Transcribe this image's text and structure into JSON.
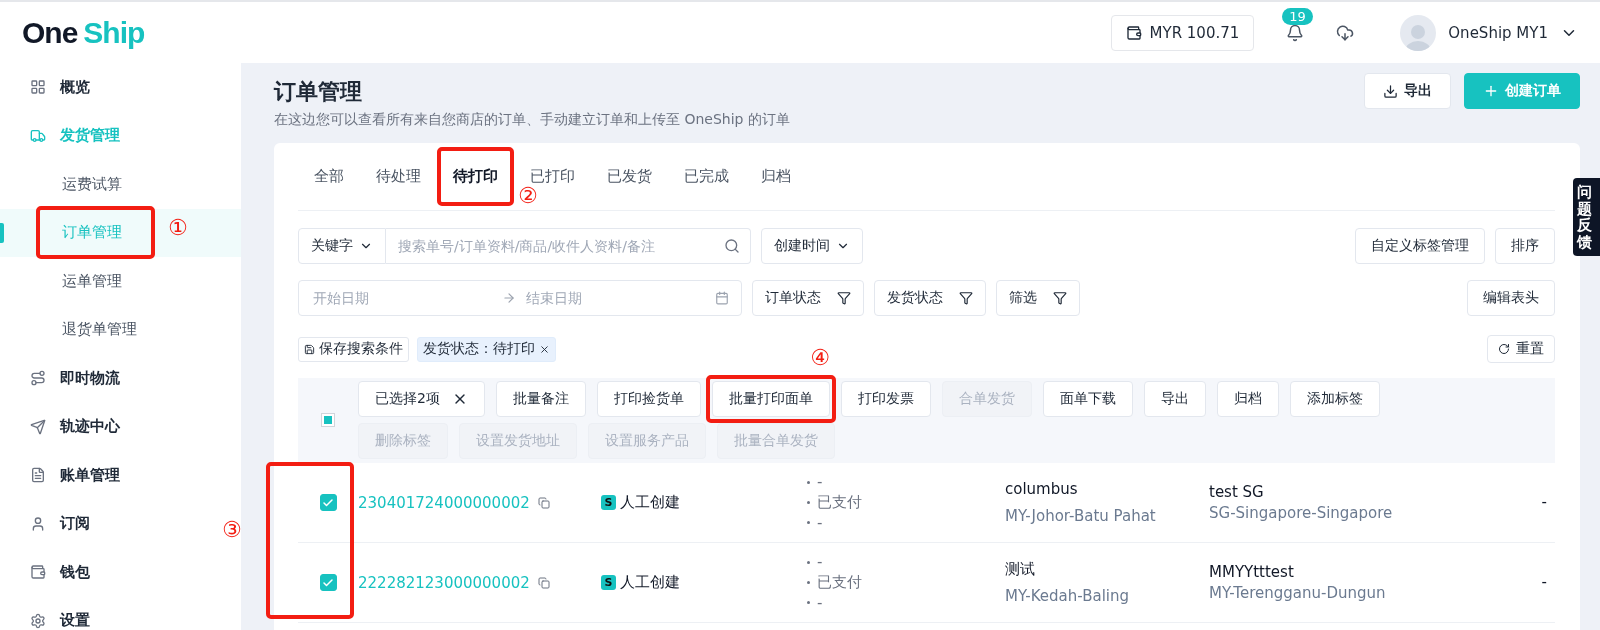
{
  "header": {
    "logo_left": "One",
    "logo_right": "Ship",
    "balance": "MYR 100.71",
    "notification_count": "19",
    "user_name": "OneShip MY1"
  },
  "sidebar": {
    "items": [
      {
        "label": "概览",
        "selected": false
      },
      {
        "label": "发货管理",
        "selected": false,
        "children": [
          {
            "label": "运费试算",
            "selected": false
          },
          {
            "label": "订单管理",
            "selected": true,
            "annotation": "①"
          },
          {
            "label": "运单管理",
            "selected": false
          },
          {
            "label": "退货单管理",
            "selected": false
          }
        ]
      },
      {
        "label": "即时物流",
        "selected": false
      },
      {
        "label": "轨迹中心",
        "selected": false
      },
      {
        "label": "账单管理",
        "selected": false
      },
      {
        "label": "订阅",
        "selected": false
      },
      {
        "label": "钱包",
        "selected": false
      },
      {
        "label": "设置",
        "selected": false
      }
    ]
  },
  "page": {
    "title": "订单管理",
    "subtitle": "在这边您可以查看所有来自您商店的订单、手动建立订单和上传至 OneShip 的订单",
    "export_button": "导出",
    "create_button": "创建订单"
  },
  "tabs": [
    {
      "label": "全部",
      "selected": false
    },
    {
      "label": "待处理",
      "selected": false
    },
    {
      "label": "待打印",
      "selected": true,
      "annotation": "②"
    },
    {
      "label": "已打印",
      "selected": false
    },
    {
      "label": "已发货",
      "selected": false
    },
    {
      "label": "已完成",
      "selected": false
    },
    {
      "label": "归档",
      "selected": false
    }
  ],
  "filters": {
    "keyword_select": "关键字",
    "search_placeholder": "搜索单号/订单资料/商品/收件人资料/备注",
    "time_select": "创建时间",
    "tag_manage_button": "自定义标签管理",
    "sort_button": "排序",
    "start_placeholder": "开始日期",
    "end_placeholder": "结束日期",
    "status_filters": [
      "订单状态",
      "发货状态",
      "筛选"
    ],
    "edit_columns_button": "编辑表头",
    "save_search": "保存搜索条件",
    "active_filter": "发货状态：待打印",
    "reset_button": "重置"
  },
  "table": {
    "select_all_partial": true,
    "checkbox_annotation": "③",
    "bulk_actions": [
      {
        "label": "已选择2项",
        "kind": "clear"
      },
      {
        "label": "批量备注",
        "kind": "action",
        "disabled": false
      },
      {
        "label": "打印捡货单",
        "kind": "action",
        "disabled": false
      },
      {
        "label": "批量打印面单",
        "kind": "action",
        "disabled": false,
        "annotation": "④"
      },
      {
        "label": "打印发票",
        "kind": "action",
        "disabled": false
      },
      {
        "label": "合单发货",
        "kind": "action",
        "disabled": true
      },
      {
        "label": "面单下载",
        "kind": "action",
        "disabled": false
      },
      {
        "label": "导出",
        "kind": "action",
        "disabled": false
      },
      {
        "label": "归档",
        "kind": "action",
        "disabled": false
      },
      {
        "label": "添加标签",
        "kind": "action",
        "disabled": false
      },
      {
        "label": "删除标签",
        "kind": "action",
        "disabled": true
      },
      {
        "label": "设置发货地址",
        "kind": "action",
        "disabled": true
      },
      {
        "label": "设置服务产品",
        "kind": "action",
        "disabled": true
      },
      {
        "label": "批量合单发货",
        "kind": "action",
        "disabled": true
      }
    ],
    "rows": [
      {
        "selected": true,
        "order_number": "230401724000000002",
        "source_badge": "S",
        "source": "人工创建",
        "status_lines": [
          "-",
          "已支付",
          "-"
        ],
        "sender_name": "columbus",
        "sender_region": "MY-Johor-Batu Pahat",
        "receiver_name": "test SG",
        "receiver_region": "SG-Singapore-Singapore",
        "column_7": "-"
      },
      {
        "selected": true,
        "order_number": "222282123000000002",
        "source_badge": "S",
        "source": "人工创建",
        "status_lines": [
          "-",
          "已支付",
          "-"
        ],
        "sender_name": "测试",
        "sender_region": "MY-Kedah-Baling",
        "receiver_name": "MMYYtttest",
        "receiver_region": "MY-Terengganu-Dungun",
        "column_7": "-"
      }
    ]
  },
  "feedback_tab": "问题反馈"
}
